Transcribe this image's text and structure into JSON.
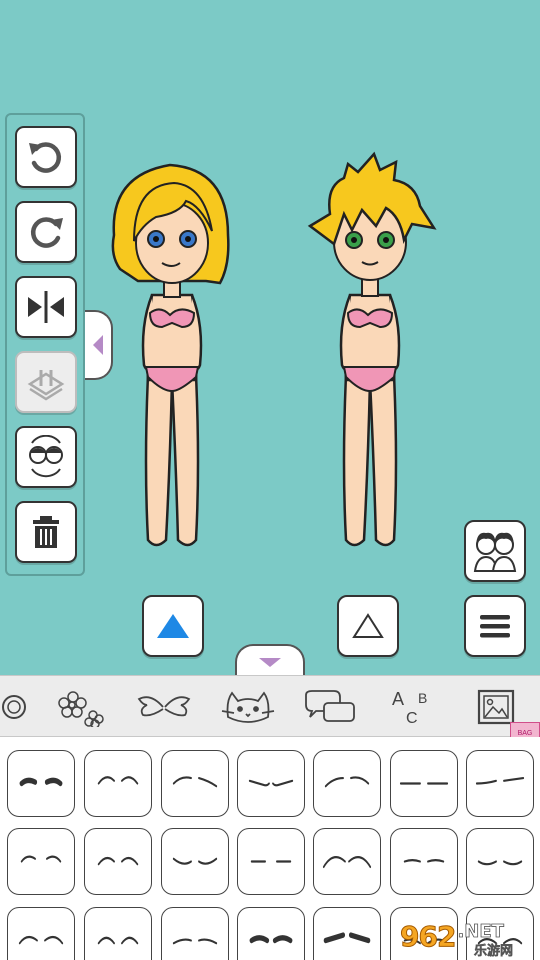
{
  "toolbar": {
    "buttons": [
      {
        "name": "undo",
        "icon": "undo-icon",
        "enabled": true
      },
      {
        "name": "redo",
        "icon": "redo-icon",
        "enabled": true
      },
      {
        "name": "flip",
        "icon": "flip-horizontal-icon",
        "enabled": true
      },
      {
        "name": "swap",
        "icon": "swap-layers-icon",
        "enabled": false
      },
      {
        "name": "swap-characters",
        "icon": "swap-characters-icon",
        "enabled": true
      },
      {
        "name": "delete",
        "icon": "trash-icon",
        "enabled": true
      }
    ]
  },
  "characters": [
    {
      "name": "girl",
      "hair_color": "#f7c81e",
      "eye_color": "#3a78c9"
    },
    {
      "name": "boy",
      "hair_color": "#f7c81e",
      "eye_color": "#3aa04a"
    }
  ],
  "controls": {
    "select_left": {
      "icon": "triangle-up-filled-icon",
      "active": true
    },
    "select_right": {
      "icon": "triangle-up-outline-icon",
      "active": false
    },
    "menu": {
      "icon": "hamburger-icon"
    },
    "pair": {
      "icon": "couple-icon"
    }
  },
  "categories": [
    {
      "name": "accessory",
      "icon": "ring-icon"
    },
    {
      "name": "flowers",
      "icon": "flower-icon"
    },
    {
      "name": "wings",
      "icon": "wings-icon"
    },
    {
      "name": "cat",
      "icon": "cat-icon"
    },
    {
      "name": "speech",
      "icon": "speech-bubble-icon"
    },
    {
      "name": "text",
      "icon": "abc-icon",
      "label": "ABC"
    },
    {
      "name": "background",
      "icon": "image-icon"
    }
  ],
  "eyebrow_styles_count": 21,
  "badge": {
    "text": "BAG"
  },
  "watermark": {
    "number": "962",
    "suffix": ".NET",
    "sub": "乐游网"
  },
  "colors": {
    "background": "#7ccac6",
    "accent_blue": "#1e88e5",
    "drawer_tab_arrow": "#b58ac6"
  }
}
